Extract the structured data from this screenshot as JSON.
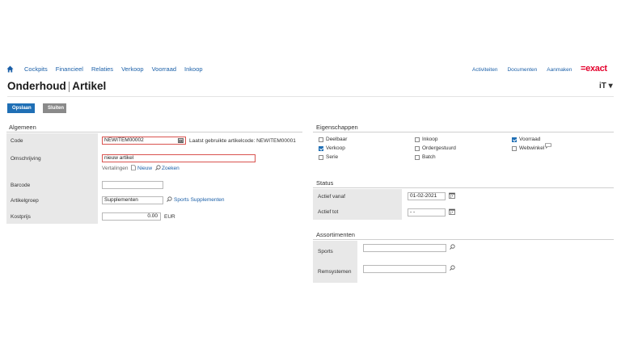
{
  "nav": {
    "items": [
      "Cockpits",
      "Financieel",
      "Relaties",
      "Verkoop",
      "Voorraad",
      "Inkoop"
    ],
    "right": [
      "Activiteiten",
      "Documenten",
      "Aanmaken"
    ],
    "logo": "=exact"
  },
  "header": {
    "title_a": "Onderhoud",
    "title_b": "Artikel",
    "sep": "|",
    "right_icon": "iT ▾"
  },
  "toolbar": {
    "save": "Opslaan",
    "close": "Sluiten"
  },
  "algemeen": {
    "title": "Algemeen",
    "code_label": "Code",
    "code_value": "NEWITEM00002",
    "last_code": "Laatst gebruikte artikelcode: NEWITEM00001",
    "desc_label": "Omschrijving",
    "desc_value": "nieuw artikel",
    "translations": "Vertalingen",
    "new_link": "Nieuw",
    "search_link": "Zoeken",
    "barcode_label": "Barcode",
    "barcode_value": "",
    "group_label": "Artikelgroep",
    "group_value": "Supplementen",
    "group_link": "Sports Supplementen",
    "cost_label": "Kostprijs",
    "cost_value": "0.00",
    "currency": "EUR"
  },
  "eigenschappen": {
    "title": "Eigenschappen",
    "checks": [
      {
        "label": "Deelbaar",
        "checked": false
      },
      {
        "label": "Inkoop",
        "checked": false
      },
      {
        "label": "Voorraad",
        "checked": true
      },
      {
        "label": "Verkoop",
        "checked": true
      },
      {
        "label": "Ordergestuurd",
        "checked": false
      },
      {
        "label": "Webwinkel",
        "checked": false
      },
      {
        "label": "Serie",
        "checked": false
      },
      {
        "label": "Batch",
        "checked": false
      }
    ]
  },
  "status": {
    "title": "Status",
    "from_label": "Actief vanaf",
    "from_value": "01-02-2021",
    "to_label": "Actief tot",
    "to_value": "- -"
  },
  "assortimenten": {
    "title": "Assortimenten",
    "sports_label": "Sports",
    "rem_label": "Remsystemen"
  },
  "colors": {
    "accent": "#1f6fb5",
    "brand": "#e4032e",
    "link": "#1a5fa8",
    "label_bg": "#e8e8e8"
  }
}
